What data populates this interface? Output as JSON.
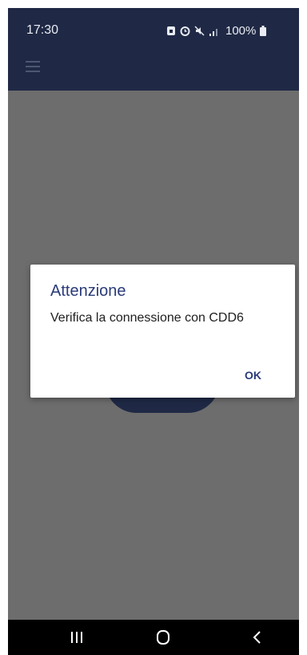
{
  "status_bar": {
    "time": "17:30",
    "battery": "100%",
    "icons": [
      "sim-lock-icon",
      "alarm-icon",
      "mute-icon",
      "signal-icon",
      "battery-icon"
    ]
  },
  "app_bar": {
    "menu_icon": "hamburger-menu-icon"
  },
  "dialog": {
    "title": "Attenzione",
    "message": "Verifica la connessione con CDD6",
    "ok_label": "OK"
  },
  "nav_bar": {
    "icons": [
      "recents-icon",
      "home-icon",
      "back-icon"
    ]
  },
  "colors": {
    "app_bar": "#1f2945",
    "scrim": "#6d6d6d",
    "dialog_accent": "#2a3a79"
  }
}
